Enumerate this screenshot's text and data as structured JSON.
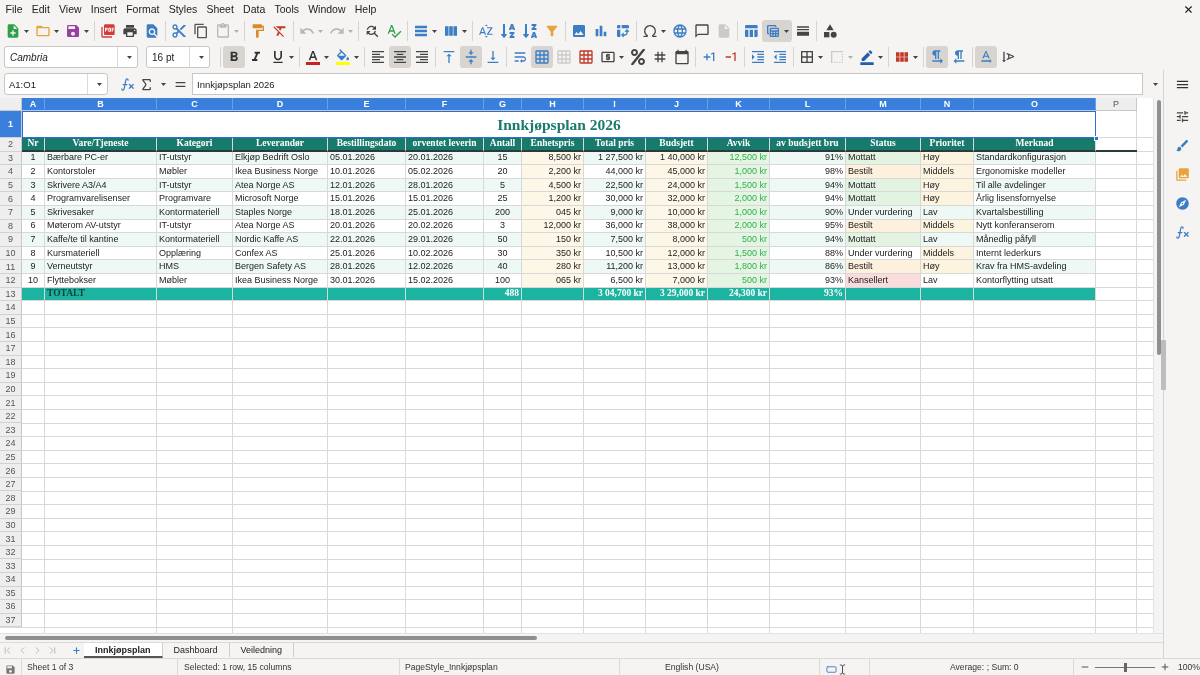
{
  "menu": [
    "File",
    "Edit",
    "View",
    "Insert",
    "Format",
    "Styles",
    "Sheet",
    "Data",
    "Tools",
    "Window",
    "Help"
  ],
  "standard_toolbar": [
    {
      "active": false,
      "disabled": false
    },
    {
      "active": false,
      "disabled": false
    },
    {
      "active": false,
      "disabled": false
    },
    {
      "active": false,
      "disabled": false
    },
    {
      "active": false,
      "disabled": false
    },
    {
      "active": false,
      "disabled": false
    },
    {
      "active": false,
      "disabled": false
    },
    {
      "active": false,
      "disabled": false
    },
    {
      "active": false,
      "disabled": true
    },
    {
      "active": false,
      "disabled": false
    },
    {
      "active": false,
      "disabled": false
    },
    {
      "active": false,
      "disabled": true
    },
    {
      "active": false,
      "disabled": true
    },
    {
      "active": false,
      "disabled": false
    },
    {
      "active": false,
      "disabled": false
    },
    {
      "active": false,
      "disabled": false
    },
    {
      "active": false,
      "disabled": false
    },
    {
      "active": false,
      "disabled": false
    },
    {
      "active": false,
      "disabled": false
    },
    {
      "active": false,
      "disabled": false
    },
    {
      "active": false,
      "disabled": false
    },
    {
      "active": false,
      "disabled": false
    },
    {
      "active": false,
      "disabled": false
    },
    {
      "active": false,
      "disabled": false
    },
    {
      "active": false,
      "disabled": false
    },
    {
      "active": false,
      "disabled": false
    },
    {
      "active": false,
      "disabled": false
    },
    {
      "active": false,
      "disabled": true
    },
    {
      "active": false,
      "disabled": false
    },
    {
      "active": true,
      "disabled": false
    },
    {
      "active": false,
      "disabled": false
    },
    {
      "active": false,
      "disabled": false
    }
  ],
  "formatting_toolbar": {
    "font_name": "Cambria",
    "font_size": "16 pt",
    "buttons": [
      {
        "active": true,
        "disabled": false
      },
      {
        "active": false,
        "disabled": false
      },
      {
        "active": false,
        "disabled": false
      },
      {
        "active": false,
        "disabled": false
      },
      {
        "active": false,
        "disabled": false
      },
      {
        "active": false,
        "disabled": false
      },
      {
        "active": true,
        "disabled": false
      },
      {
        "active": false,
        "disabled": false
      },
      {
        "active": false,
        "disabled": false
      },
      {
        "active": true,
        "disabled": false
      },
      {
        "active": false,
        "disabled": false
      },
      {
        "active": false,
        "disabled": false
      },
      {
        "active": true,
        "disabled": false
      },
      {
        "active": false,
        "disabled": true
      },
      {
        "active": false,
        "disabled": false
      },
      {
        "active": false,
        "disabled": false
      },
      {
        "active": false,
        "disabled": false
      },
      {
        "active": false,
        "disabled": false
      },
      {
        "active": false,
        "disabled": false
      },
      {
        "active": false,
        "disabled": false
      },
      {
        "active": false,
        "disabled": false
      },
      {
        "active": false,
        "disabled": false
      },
      {
        "active": false,
        "disabled": false
      },
      {
        "active": false,
        "disabled": false
      },
      {
        "active": false,
        "disabled": true
      },
      {
        "active": false,
        "disabled": false
      },
      {
        "active": false,
        "disabled": false
      },
      {
        "active": true,
        "disabled": false
      },
      {
        "active": false,
        "disabled": false
      },
      {
        "active": true,
        "disabled": false
      },
      {
        "active": false,
        "disabled": false
      }
    ]
  },
  "formula_bar": {
    "name_box": "A1:O1",
    "content": "Innkjøpsplan 2026"
  },
  "sheet": {
    "column_letters": [
      {
        "label": "A",
        "selected": true
      },
      {
        "label": "B",
        "selected": true
      },
      {
        "label": "C",
        "selected": true
      },
      {
        "label": "D",
        "selected": true
      },
      {
        "label": "E",
        "selected": true
      },
      {
        "label": "F",
        "selected": true
      },
      {
        "label": "G",
        "selected": true
      },
      {
        "label": "H",
        "selected": true
      },
      {
        "label": "I",
        "selected": true
      },
      {
        "label": "J",
        "selected": true
      },
      {
        "label": "K",
        "selected": true
      },
      {
        "label": "L",
        "selected": true
      },
      {
        "label": "M",
        "selected": true
      },
      {
        "label": "N",
        "selected": true
      },
      {
        "label": "O",
        "selected": true
      },
      {
        "label": "P",
        "selected": false
      }
    ],
    "row_numbers": [
      {
        "label": "1",
        "selected": true
      },
      {
        "label": "2",
        "selected": false
      },
      {
        "label": "3",
        "selected": false
      },
      {
        "label": "4",
        "selected": false
      },
      {
        "label": "5",
        "selected": false
      },
      {
        "label": "6",
        "selected": false
      },
      {
        "label": "7",
        "selected": false
      },
      {
        "label": "8",
        "selected": false
      },
      {
        "label": "9",
        "selected": false
      },
      {
        "label": "10",
        "selected": false
      },
      {
        "label": "11",
        "selected": false
      },
      {
        "label": "12",
        "selected": false
      },
      {
        "label": "13",
        "selected": false
      },
      {
        "label": "14",
        "selected": false
      },
      {
        "label": "15",
        "selected": false
      },
      {
        "label": "16",
        "selected": false
      },
      {
        "label": "17",
        "selected": false
      },
      {
        "label": "18",
        "selected": false
      },
      {
        "label": "19",
        "selected": false
      },
      {
        "label": "20",
        "selected": false
      },
      {
        "label": "21",
        "selected": false
      },
      {
        "label": "22",
        "selected": false
      },
      {
        "label": "23",
        "selected": false
      },
      {
        "label": "24",
        "selected": false
      },
      {
        "label": "25",
        "selected": false
      },
      {
        "label": "26",
        "selected": false
      },
      {
        "label": "27",
        "selected": false
      },
      {
        "label": "28",
        "selected": false
      },
      {
        "label": "29",
        "selected": false
      },
      {
        "label": "30",
        "selected": false
      },
      {
        "label": "31",
        "selected": false
      },
      {
        "label": "32",
        "selected": false
      },
      {
        "label": "33",
        "selected": false
      },
      {
        "label": "34",
        "selected": false
      },
      {
        "label": "35",
        "selected": false
      },
      {
        "label": "36",
        "selected": false
      },
      {
        "label": "37",
        "selected": false
      }
    ],
    "title": {
      "text": "Innkjøpsplan 2026",
      "selected": true
    },
    "headings": [
      "Nr",
      "Vare/Tjeneste",
      "Kategori",
      "Leverandør",
      "Bestillingsdato",
      "orventet leverin",
      "Antall",
      "Enhetspris",
      "Total pris",
      "Budsjett",
      "Avvik",
      "av budsjett bru",
      "Status",
      "Prioritet",
      "Merknad"
    ],
    "rows": [
      {
        "nr": "1",
        "item": "Bærbare PC-er",
        "category": "IT-utstyr",
        "supplier": "Elkjøp Bedrift Oslo",
        "order_date": "05.01.2026",
        "delivery_date": "20.01.2026",
        "quantity": "15",
        "unit_price": "8,500 kr",
        "total_price": "1 27,500 kr",
        "budget": "1 40,000 kr",
        "variance": "12,500 kr",
        "budget_share": "91%",
        "status": {
          "text": "Mottatt",
          "color": "#e3f3e1"
        },
        "priority": {
          "text": "Høy",
          "color": "#fdf4e0"
        },
        "note": "Standardkonfigurasjon"
      },
      {
        "nr": "2",
        "item": "Kontorstoler",
        "category": "Møbler",
        "supplier": "Ikea Business Norge",
        "order_date": "10.01.2026",
        "delivery_date": "05.02.2026",
        "quantity": "20",
        "unit_price": "2,200 kr",
        "total_price": "44,000 kr",
        "budget": "45,000 kr",
        "variance": "1,000 kr",
        "budget_share": "98%",
        "status": {
          "text": "Bestilt",
          "color": "#fdf0dc"
        },
        "priority": {
          "text": "Middels",
          "color": "#fdf4e0"
        },
        "note": "Ergonomiske modeller"
      },
      {
        "nr": "3",
        "item": "Skrivere A3/A4",
        "category": "IT-utstyr",
        "supplier": "Atea Norge AS",
        "order_date": "12.01.2026",
        "delivery_date": "28.01.2026",
        "quantity": "5",
        "unit_price": "4,500 kr",
        "total_price": "22,500 kr",
        "budget": "24,000 kr",
        "variance": "1,500 kr",
        "budget_share": "94%",
        "status": {
          "text": "Mottatt",
          "color": "#e3f3e1"
        },
        "priority": {
          "text": "Høy",
          "color": "#fdf4e0"
        },
        "note": "Til alle avdelinger"
      },
      {
        "nr": "4",
        "item": "Programvarelisenser",
        "category": "Programvare",
        "supplier": "Microsoft Norge",
        "order_date": "15.01.2026",
        "delivery_date": "15.01.2026",
        "quantity": "25",
        "unit_price": "1,200 kr",
        "total_price": "30,000 kr",
        "budget": "32,000 kr",
        "variance": "2,000 kr",
        "budget_share": "94%",
        "status": {
          "text": "Mottatt",
          "color": "#e3f3e1"
        },
        "priority": {
          "text": "Høy",
          "color": "#fdf4e0"
        },
        "note": "Årlig lisensfornyelse"
      },
      {
        "nr": "5",
        "item": "Skrivesaker",
        "category": "Kontormateriell",
        "supplier": "Staples Norge",
        "order_date": "18.01.2026",
        "delivery_date": "25.01.2026",
        "quantity": "200",
        "unit_price": "045 kr",
        "total_price": "9,000 kr",
        "budget": "10,000 kr",
        "variance": "1,000 kr",
        "budget_share": "90%",
        "status": {
          "text": "Under vurdering"
        },
        "priority": {
          "text": "Lav"
        },
        "note": "Kvartalsbestilling"
      },
      {
        "nr": "6",
        "item": "Møterom AV-utstyr",
        "category": "IT-utstyr",
        "supplier": "Atea Norge AS",
        "order_date": "20.01.2026",
        "delivery_date": "20.02.2026",
        "quantity": "3",
        "unit_price": "12,000 kr",
        "total_price": "36,000 kr",
        "budget": "38,000 kr",
        "variance": "2,000 kr",
        "budget_share": "95%",
        "status": {
          "text": "Bestilt",
          "color": "#fdf0dc"
        },
        "priority": {
          "text": "Middels",
          "color": "#fdf4e0"
        },
        "note": "Nytt konferanserom"
      },
      {
        "nr": "7",
        "item": "Kaffe/te til kantine",
        "category": "Kontormateriell",
        "supplier": "Nordic Kaffe AS",
        "order_date": "22.01.2026",
        "delivery_date": "29.01.2026",
        "quantity": "50",
        "unit_price": "150 kr",
        "total_price": "7,500 kr",
        "budget": "8,000 kr",
        "variance": "500 kr",
        "budget_share": "94%",
        "status": {
          "text": "Mottatt",
          "color": "#e3f3e1"
        },
        "priority": {
          "text": "Lav"
        },
        "note": "Månedlig påfyll"
      },
      {
        "nr": "8",
        "item": "Kursmateriell",
        "category": "Opplæring",
        "supplier": "Confex AS",
        "order_date": "25.01.2026",
        "delivery_date": "10.02.2026",
        "quantity": "30",
        "unit_price": "350 kr",
        "total_price": "10,500 kr",
        "budget": "12,000 kr",
        "variance": "1,500 kr",
        "budget_share": "88%",
        "status": {
          "text": "Under vurdering"
        },
        "priority": {
          "text": "Middels",
          "color": "#fdf4e0"
        },
        "note": "Internt lederkurs"
      },
      {
        "nr": "9",
        "item": "Verneutstyr",
        "category": "HMS",
        "supplier": "Bergen Safety AS",
        "order_date": "28.01.2026",
        "delivery_date": "12.02.2026",
        "quantity": "40",
        "unit_price": "280 kr",
        "total_price": "11,200 kr",
        "budget": "13,000 kr",
        "variance": "1,800 kr",
        "budget_share": "86%",
        "status": {
          "text": "Bestilt",
          "color": "#fdf0dc"
        },
        "priority": {
          "text": "Høy",
          "color": "#fdf4e0"
        },
        "note": "Krav fra HMS-avdeling"
      },
      {
        "nr": "10",
        "item": "Flyttebokser",
        "category": "Møbler",
        "supplier": "Ikea Business Norge",
        "order_date": "30.01.2026",
        "delivery_date": "15.02.2026",
        "quantity": "100",
        "unit_price": "065 kr",
        "total_price": "6,500 kr",
        "budget": "7,000 kr",
        "variance": "500 kr",
        "budget_share": "93%",
        "status": {
          "text": "Kansellert",
          "color": "#fadcdc"
        },
        "priority": {
          "text": "Lav"
        },
        "note": "Kontorflytting utsatt"
      }
    ],
    "totals": {
      "label": "TOTALT",
      "quantity": "488",
      "total_price": "3 04,700 kr",
      "budget": "3 29,000 kr",
      "variance": "24,300 kr",
      "budget_share": "93%"
    }
  },
  "sheet_tabs": [
    {
      "label": "Innkjøpsplan",
      "selected": true
    },
    {
      "label": "Dashboard",
      "selected": false
    },
    {
      "label": "Veiledning",
      "selected": false
    }
  ],
  "status_bar": {
    "sheet": "Sheet 1 of 3",
    "selection": "Selected: 1 row, 15 columns",
    "page_style": "PageStyle_Innkjøpsplan",
    "language": "English (USA)",
    "summary": "Average: ; Sum: 0",
    "zoom_slider": {
      "level": 0.5
    },
    "zoom": "100%"
  }
}
